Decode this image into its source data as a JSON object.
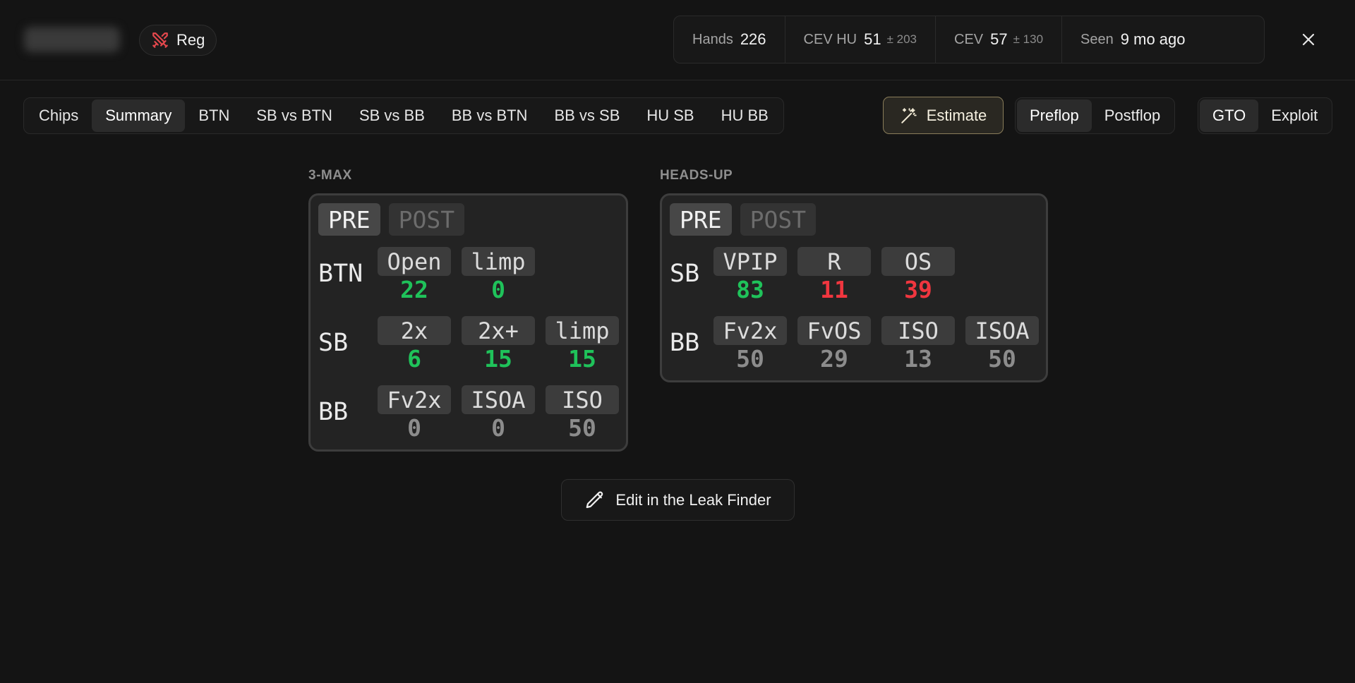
{
  "header": {
    "badge_label": "Reg",
    "stats": [
      {
        "label": "Hands",
        "value": "226",
        "dev": ""
      },
      {
        "label": "CEV HU",
        "value": "51",
        "dev": "± 203"
      },
      {
        "label": "CEV",
        "value": "57",
        "dev": "± 130"
      },
      {
        "label": "Seen",
        "value": "9 mo ago",
        "dev": ""
      }
    ]
  },
  "tabs": [
    "Chips",
    "Summary",
    "BTN",
    "SB vs BTN",
    "SB vs BB",
    "BB vs BTN",
    "BB vs SB",
    "HU SB",
    "HU BB"
  ],
  "active_tab": "Summary",
  "estimate_label": "Estimate",
  "phase_options": [
    "Preflop",
    "Postflop"
  ],
  "mode_options": [
    "GTO",
    "Exploit"
  ],
  "three_max": {
    "title": "3-MAX",
    "modes": [
      "PRE",
      "POST"
    ],
    "rows": [
      {
        "pos": "BTN",
        "cells": [
          {
            "label": "Open",
            "value": "22",
            "color": "green"
          },
          {
            "label": "limp",
            "value": "0",
            "color": "green"
          }
        ]
      },
      {
        "pos": "SB",
        "cells": [
          {
            "label": "2x",
            "value": "6",
            "color": "green"
          },
          {
            "label": "2x+",
            "value": "15",
            "color": "green"
          },
          {
            "label": "limp",
            "value": "15",
            "color": "green"
          }
        ]
      },
      {
        "pos": "BB",
        "cells": [
          {
            "label": "Fv2x",
            "value": "0",
            "color": "grey"
          },
          {
            "label": "ISOA",
            "value": "0",
            "color": "grey"
          },
          {
            "label": "ISO",
            "value": "50",
            "color": "grey"
          }
        ]
      }
    ]
  },
  "heads_up": {
    "title": "HEADS-UP",
    "modes": [
      "PRE",
      "POST"
    ],
    "rows": [
      {
        "pos": "SB",
        "cells": [
          {
            "label": "VPIP",
            "value": "83",
            "color": "green"
          },
          {
            "label": "R",
            "value": "11",
            "color": "red"
          },
          {
            "label": "OS",
            "value": "39",
            "color": "red"
          }
        ]
      },
      {
        "pos": "BB",
        "cells": [
          {
            "label": "Fv2x",
            "value": "50",
            "color": "grey"
          },
          {
            "label": "FvOS",
            "value": "29",
            "color": "grey"
          },
          {
            "label": "ISO",
            "value": "13",
            "color": "grey"
          },
          {
            "label": "ISOA",
            "value": "50",
            "color": "grey"
          }
        ]
      }
    ]
  },
  "leak_finder_label": "Edit in the Leak Finder",
  "colors": {
    "green": "#1fc25a",
    "red": "#f0363f",
    "accent_border": "#8a7d5a"
  }
}
